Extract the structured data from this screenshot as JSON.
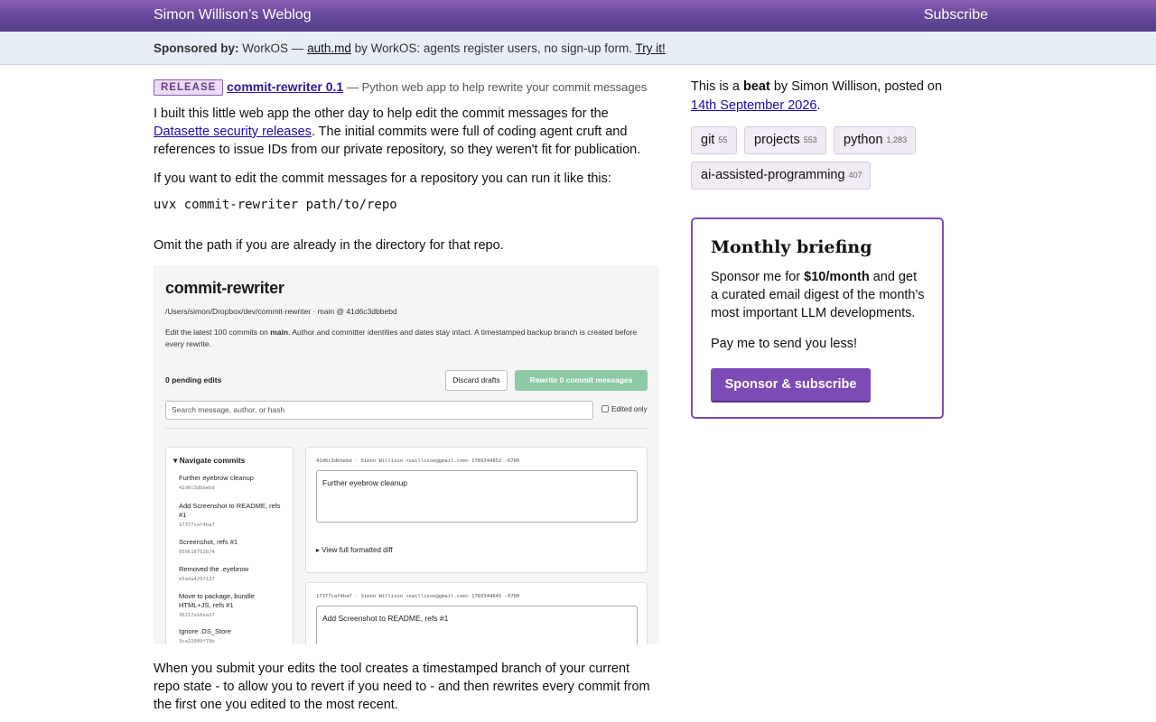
{
  "header": {
    "site_title": "Simon Willison’s Weblog",
    "subscribe_label": "Subscribe"
  },
  "sponsor_bar": {
    "label": "Sponsored by:",
    "sponsor": "WorkOS —",
    "link_text": "auth.md",
    "middle": "by WorkOS: agents register users, no sign-up form.",
    "cta": "Try it!"
  },
  "post": {
    "badge": "RELEASE",
    "title": "commit-rewriter 0.1",
    "title_desc": "— Python web app to help rewrite your commit messages",
    "p1_a": "I built this little web app the other day to help edit the commit messages for the",
    "p1_link": "Datasette security releases",
    "p1_b": ". The initial commits were full of coding agent cruft and references to issue IDs from our private repository, so they weren't fit for publication.",
    "p2": "If you want to edit the commit messages for a repository you can run it like this:",
    "code": "uvx commit-rewriter path/to/repo",
    "p3": "Omit the path if you are already in the directory for that repo.",
    "p4": "When you submit your edits the tool creates a timestamped branch of your current repo state - to allow you to revert if you need to - and then rewrites every commit from the first one you edited to the most recent."
  },
  "screenshot": {
    "title": "commit-rewriter",
    "path": "/Users/simon/Dropbox/dev/commit-rewriter · main @ 41d6c3dbbebd",
    "desc_a": "Edit the latest 100 commits on ",
    "desc_branch": "main",
    "desc_b": ". Author and committer identities and dates stay intact. A timestamped backup branch is created before every rewrite.",
    "pending": "0 pending edits",
    "discard": "Discard drafts",
    "rewrite": "Rewrite 0 commit messages",
    "search_placeholder": "Search message, author, or hash",
    "edited_only": "Edited only",
    "nav_heading": "▾ Navigate commits",
    "nav_items": [
      {
        "label": "Further eyebrow cleanup",
        "hash": "41d6c3dbbebd"
      },
      {
        "label": "Add Screenshot to README, refs #1",
        "hash": "17377caf4ba7"
      },
      {
        "label": "Screenshot, refs #1",
        "hash": "050618752b74"
      },
      {
        "label": "Removed the .eyebrow",
        "hash": "e5ada420f137"
      },
      {
        "label": "Move to package, bundle HTML+JS, refs #1",
        "hash": "36217a16ea17"
      },
      {
        "label": "Ignore .DS_Store",
        "hash": "3ca22099f79b"
      }
    ],
    "commits": [
      {
        "meta": "41d6c3dbbebd · Simon Willison <swillison@gmail.com> 1789344852 -0700",
        "message": "Further eyebrow cleanup",
        "diff": "▸ View full formatted diff"
      },
      {
        "meta": "17377caf4ba7 · Simon Willison <swillison@gmail.com> 1789344645 -0700",
        "message": "Add Screenshot to README, refs #1"
      }
    ]
  },
  "sidebar": {
    "beat_a": "This is a ",
    "beat_b": "beat",
    "beat_c": " by Simon Willison, posted on",
    "date": "14th September 2026",
    "tags": [
      {
        "name": "git",
        "count": "55"
      },
      {
        "name": "projects",
        "count": "553"
      },
      {
        "name": "python",
        "count": "1,283"
      },
      {
        "name": "ai-assisted-programming",
        "count": "407"
      }
    ],
    "briefing": {
      "title": "Monthly briefing",
      "text_a": "Sponsor me for ",
      "text_price": "$10/month",
      "text_b": " and get a curated email digest of the month's most important LLM developments.",
      "text2": "Pay me to send you less!",
      "button": "Sponsor & subscribe"
    }
  }
}
